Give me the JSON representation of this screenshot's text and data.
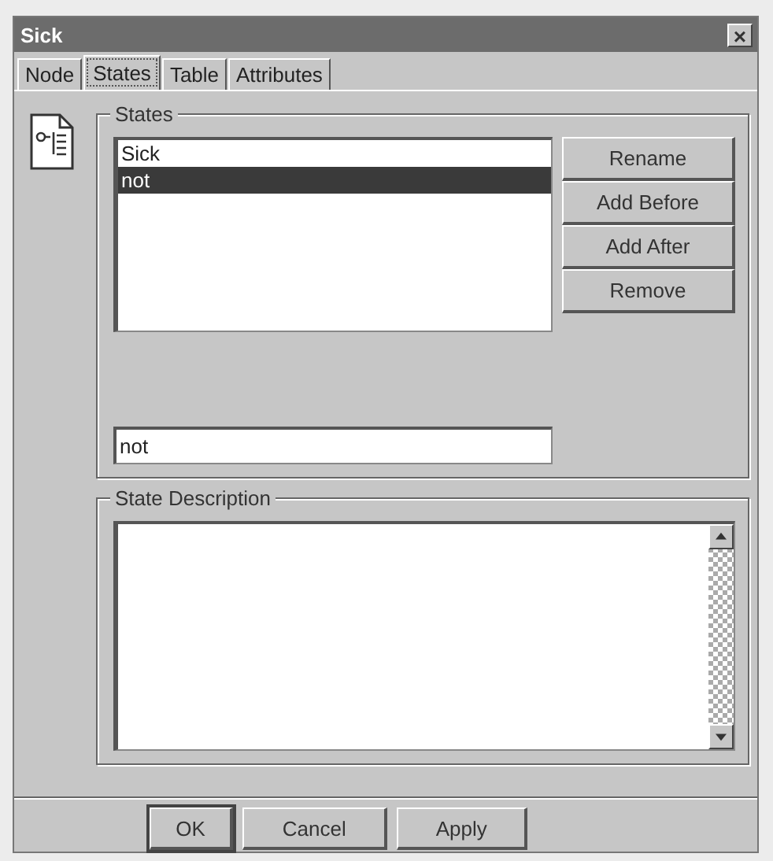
{
  "window": {
    "title": "Sick",
    "close_label": "×"
  },
  "tabs": [
    {
      "label": "Node",
      "selected": false
    },
    {
      "label": "States",
      "selected": true
    },
    {
      "label": "Table",
      "selected": false
    },
    {
      "label": "Attributes",
      "selected": false
    }
  ],
  "states_group": {
    "title": "States",
    "items": [
      {
        "label": "Sick",
        "selected": false
      },
      {
        "label": "not",
        "selected": true
      }
    ],
    "buttons": [
      "Rename",
      "Add Before",
      "Add After",
      "Remove"
    ],
    "name_field": {
      "value": "not"
    }
  },
  "description_group": {
    "title": "State Description"
  },
  "buttons": [
    {
      "label": "OK",
      "default": true
    },
    {
      "label": "Cancel",
      "default": false
    },
    {
      "label": "Apply",
      "default": false
    }
  ]
}
